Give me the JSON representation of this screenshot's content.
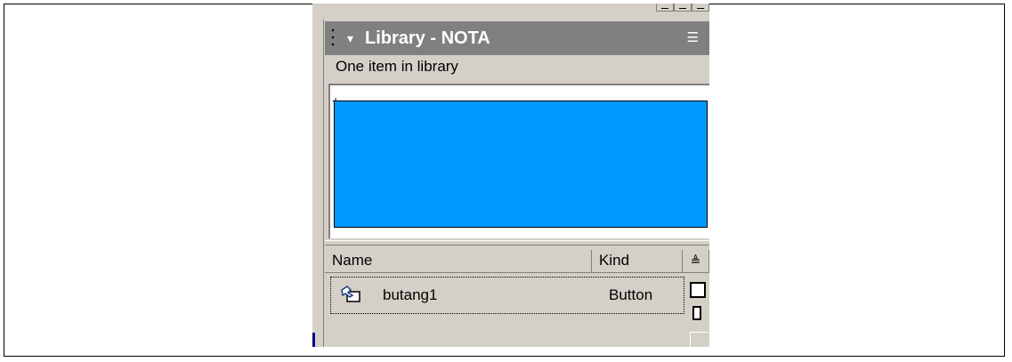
{
  "panel": {
    "title": "Library - NOTA",
    "caret_glyph": "▾",
    "menu_glyph": "☰",
    "status": "One item in library"
  },
  "table": {
    "columns": [
      "Name",
      "Kind"
    ],
    "sort_glyph": "≜",
    "rows": [
      {
        "name": "butang1",
        "kind": "Button",
        "icon": "button-symbol-icon"
      }
    ]
  },
  "colors": {
    "preview_fill": "#0099ff",
    "titlebar": "#808080",
    "panel_bg": "#d4d0c8"
  }
}
